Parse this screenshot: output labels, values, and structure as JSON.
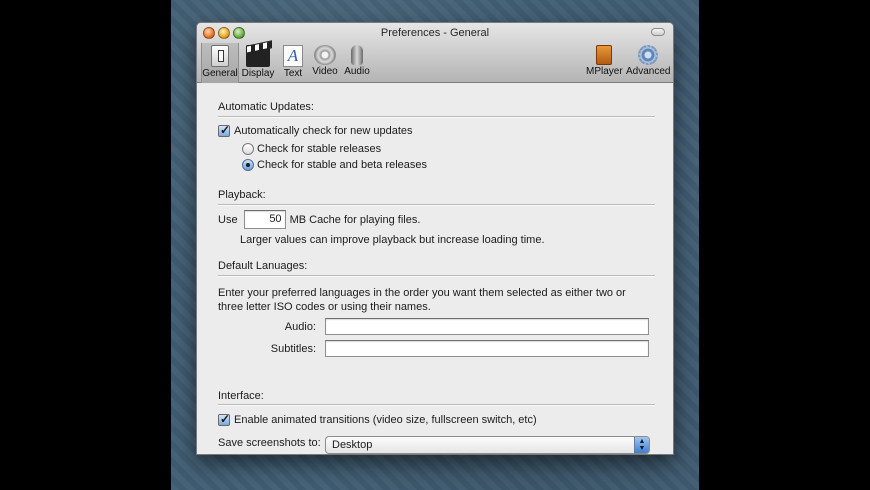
{
  "window": {
    "title": "Preferences - General"
  },
  "toolbar": {
    "items": [
      {
        "label": "General",
        "icon": "general-icon"
      },
      {
        "label": "Display",
        "icon": "clapperboard-icon"
      },
      {
        "label": "Text",
        "icon": "text-icon"
      },
      {
        "label": "Video",
        "icon": "film-reel-icon"
      },
      {
        "label": "Audio",
        "icon": "microphone-icon"
      },
      {
        "label": "MPlayer",
        "icon": "mplayer-icon"
      },
      {
        "label": "Advanced",
        "icon": "gear-icon"
      }
    ],
    "selected": "General"
  },
  "updates": {
    "title": "Automatic Updates:",
    "auto_check_label": "Automatically check for new updates",
    "auto_check": true,
    "stable_label": "Check for stable releases",
    "stable_beta_label": "Check for stable and beta releases",
    "selected": "stable_beta"
  },
  "playback": {
    "title": "Playback:",
    "use_label": "Use",
    "cache_value": "50",
    "cache_suffix": "MB Cache for playing files.",
    "hint": "Larger values can improve playback but increase loading time."
  },
  "languages": {
    "title": "Default Lanuages:",
    "description_line1": "Enter your preferred languages in the order you want them selected as either two or",
    "description_line2": "three letter ISO codes or using their names.",
    "audio_label": "Audio:",
    "audio_value": "",
    "subtitles_label": "Subtitles:",
    "subtitles_value": ""
  },
  "interface": {
    "title": "Interface:",
    "animated_label": "Enable animated transitions (video size, fullscreen switch, etc)",
    "animated": true,
    "screenshots_label": "Save screenshots to:",
    "screenshots_value": "Desktop"
  }
}
